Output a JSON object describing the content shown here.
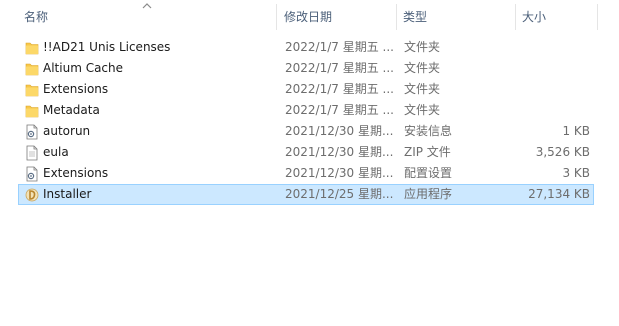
{
  "columns": {
    "name": "名称",
    "date": "修改日期",
    "type": "类型",
    "size": "大小"
  },
  "icons": {
    "folder": "folder-icon",
    "text_file": "text-file-icon",
    "settings_file": "settings-file-icon",
    "installer": "installer-icon",
    "sort": "sort-up-arrow-icon"
  },
  "colors": {
    "selection_bg": "#cce8ff",
    "selection_border": "#99d1ff",
    "folder": "#f8c74a"
  },
  "files": [
    {
      "name": "!!AD21 Unis Licenses",
      "date": "2022/1/7 星期五 ...",
      "type": "文件夹",
      "size": "",
      "icon": "folder"
    },
    {
      "name": "Altium Cache",
      "date": "2022/1/7 星期五 ...",
      "type": "文件夹",
      "size": "",
      "icon": "folder"
    },
    {
      "name": "Extensions",
      "date": "2022/1/7 星期五 ...",
      "type": "文件夹",
      "size": "",
      "icon": "folder"
    },
    {
      "name": "Metadata",
      "date": "2022/1/7 星期五 ...",
      "type": "文件夹",
      "size": "",
      "icon": "folder"
    },
    {
      "name": "autorun",
      "date": "2021/12/30 星期...",
      "type": "安装信息",
      "size": "1 KB",
      "icon": "settings_file"
    },
    {
      "name": "eula",
      "date": "2021/12/30 星期...",
      "type": "ZIP 文件",
      "size": "3,526 KB",
      "icon": "text_file"
    },
    {
      "name": "Extensions",
      "date": "2021/12/30 星期...",
      "type": "配置设置",
      "size": "3 KB",
      "icon": "settings_file"
    },
    {
      "name": "Installer",
      "date": "2021/12/25 星期...",
      "type": "应用程序",
      "size": "27,134 KB",
      "icon": "installer",
      "selected": true
    }
  ]
}
